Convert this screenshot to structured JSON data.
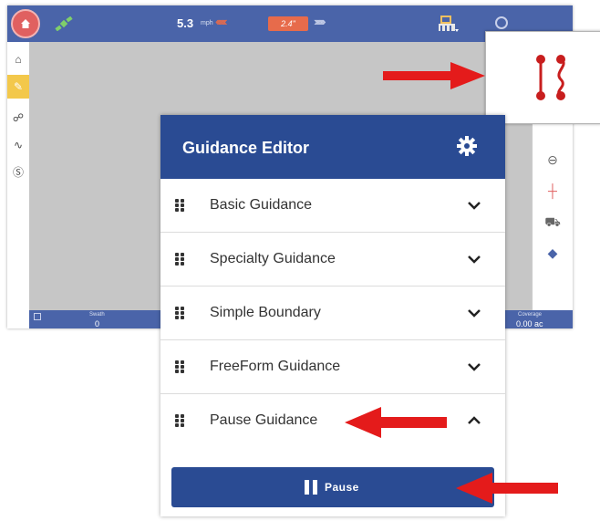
{
  "topbar": {
    "speed_value": "5.3",
    "speed_unit": "mph",
    "steer_left": "‹‹‹‹‹‹‹‹",
    "cross_track_error": "2.4\"",
    "steer_right": "››››››››"
  },
  "left_sidebar": {
    "items": [
      {
        "icon": "home-icon"
      },
      {
        "icon": "guidance-pin-icon"
      },
      {
        "icon": "operator-icon"
      },
      {
        "icon": "diagnostics-icon"
      },
      {
        "icon": "settings-s-icon"
      }
    ]
  },
  "right_sidebar": {
    "items": [
      {
        "icon": "steering-wheel-icon"
      },
      {
        "icon": "crosshair-icon"
      },
      {
        "icon": "tractor-icon"
      },
      {
        "icon": "layers-icon"
      }
    ]
  },
  "bottombar": {
    "swath_label": "Swath",
    "swath_value": "0",
    "coverage_label": "Coverage",
    "coverage_value": "0.00 ac"
  },
  "panel": {
    "title": "Guidance Editor",
    "sections": [
      {
        "label": "Basic Guidance",
        "state": "collapsed"
      },
      {
        "label": "Specialty Guidance",
        "state": "collapsed"
      },
      {
        "label": "Simple Boundary",
        "state": "collapsed"
      },
      {
        "label": "FreeForm Guidance",
        "state": "collapsed"
      },
      {
        "label": "Pause Guidance",
        "state": "expanded"
      }
    ],
    "pause_button_label": "Pause"
  },
  "colors": {
    "topbar_blue": "#4a64a9",
    "panel_blue": "#2a4b93",
    "accent_red": "#d92020",
    "guidance_yellow": "#f3c84b"
  }
}
